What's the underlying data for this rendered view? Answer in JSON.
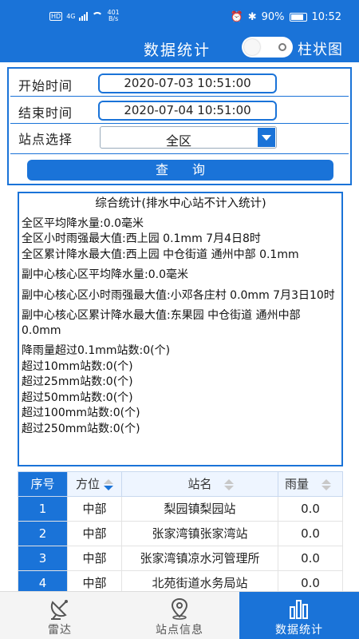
{
  "statusbar": {
    "network": "4G",
    "hd": "HD",
    "data_rate": "401",
    "data_unit": "B/s",
    "battery": "90%",
    "time": "10:52"
  },
  "header": {
    "title": "数据统计",
    "toggle_label": "柱状图",
    "toggle_on": false
  },
  "filter": {
    "start_label": "开始时间",
    "start_value": "2020-07-03 10:51:00",
    "end_label": "结束时间",
    "end_value": "2020-07-04 10:51:00",
    "station_label": "站点选择",
    "station_value": "全区",
    "query_label": "查询"
  },
  "stats": {
    "heading": "综合统计(排水中心站不计入统计)",
    "lines": [
      "全区平均降水量:0.0毫米",
      "全区小时雨强最大值:西上园 0.1mm 7月4日8时",
      "全区累计降水最大值:西上园  中仓街道  通州中部 0.1mm",
      "副中心核心区平均降水量:0.0毫米",
      "副中心核心区小时雨强最大值:小邓各庄村 0.0mm 7月3日10时",
      "副中心核心区累计降水最大值:东果园  中仓街道  通州中部  0.0mm",
      "降雨量超过0.1mm站数:0(个)",
      "超过10mm站数:0(个)",
      "超过25mm站数:0(个)",
      "超过50mm站数:0(个)",
      "超过100mm站数:0(个)",
      "超过250mm站数:0(个)"
    ]
  },
  "table": {
    "headers": [
      "序号",
      "方位",
      "站名",
      "雨量"
    ],
    "rows": [
      {
        "idx": "1",
        "dir": "中部",
        "name": "梨园镇梨园站",
        "rain": "0.0"
      },
      {
        "idx": "2",
        "dir": "中部",
        "name": "张家湾镇张家湾站",
        "rain": "0.0"
      },
      {
        "idx": "3",
        "dir": "中部",
        "name": "张家湾镇凉水河管理所",
        "rain": "0.0"
      },
      {
        "idx": "4",
        "dir": "中部",
        "name": "北苑街道水务局站",
        "rain": "0.0"
      }
    ]
  },
  "nav": {
    "items": [
      {
        "label": "雷达",
        "icon": "satellite-dish-icon"
      },
      {
        "label": "站点信息",
        "icon": "location-pin-icon"
      },
      {
        "label": "数据统计",
        "icon": "bar-chart-icon"
      }
    ],
    "active_index": 2,
    "active_color": "#1a73d8"
  }
}
